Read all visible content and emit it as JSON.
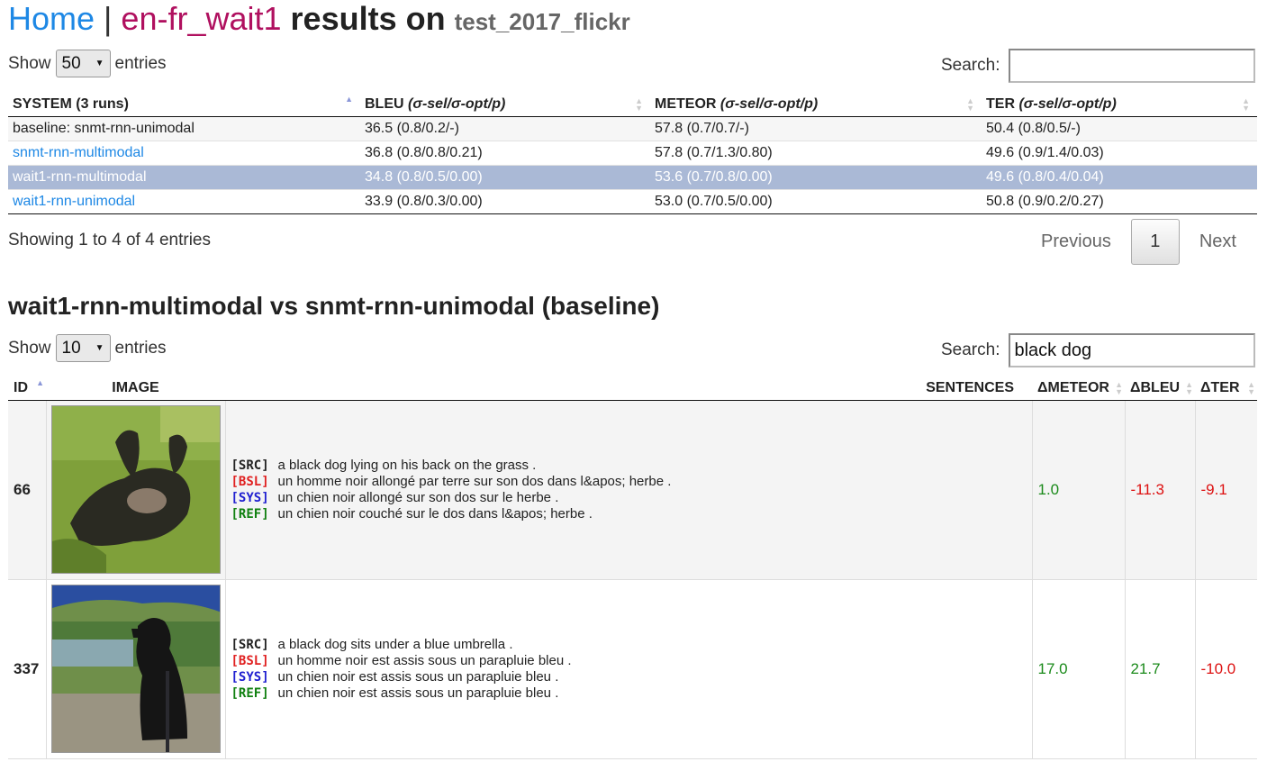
{
  "header": {
    "home": "Home",
    "separator": "|",
    "task": "en-fr_wait1",
    "results_on": "results on",
    "dataset": "test_2017_flickr"
  },
  "table1": {
    "show_label": "Show",
    "show_value": "50",
    "entries_label": "entries",
    "search_label": "Search:",
    "search_value": "",
    "columns": [
      {
        "name": "SYSTEM (3 runs)",
        "italic": ""
      },
      {
        "name": "BLEU ",
        "italic": "(σ-sel/σ-opt/p)"
      },
      {
        "name": "METEOR ",
        "italic": "(σ-sel/σ-opt/p)"
      },
      {
        "name": "TER ",
        "italic": "(σ-sel/σ-opt/p)"
      }
    ],
    "rows": [
      {
        "system": "baseline: snmt-rnn-unimodal",
        "bleu": "36.5 (0.8/0.2/-)",
        "meteor": "57.8 (0.7/0.7/-)",
        "ter": "50.4 (0.8/0.5/-)"
      },
      {
        "system": "snmt-rnn-multimodal",
        "bleu": "36.8 (0.8/0.8/0.21)",
        "meteor": "57.8 (0.7/1.3/0.80)",
        "ter": "49.6 (0.9/1.4/0.03)"
      },
      {
        "system": "wait1-rnn-multimodal",
        "bleu": "34.8 (0.8/0.5/0.00)",
        "meteor": "53.6 (0.7/0.8/0.00)",
        "ter": "49.6 (0.8/0.4/0.04)"
      },
      {
        "system": "wait1-rnn-unimodal",
        "bleu": "33.9 (0.8/0.3/0.00)",
        "meteor": "53.0 (0.7/0.5/0.00)",
        "ter": "50.8 (0.9/0.2/0.27)"
      }
    ],
    "info": "Showing 1 to 4 of 4 entries",
    "pager": {
      "previous": "Previous",
      "current": "1",
      "next": "Next"
    }
  },
  "comparison": {
    "title": "wait1-rnn-multimodal vs snmt-rnn-unimodal (baseline)",
    "show_label": "Show",
    "show_value": "10",
    "entries_label": "entries",
    "search_label": "Search:",
    "search_value": "black dog",
    "columns": {
      "id": "ID",
      "image": "IMAGE",
      "sentences": "SENTENCES",
      "dmeteor": "ΔMETEOR",
      "dbleu": "ΔBLEU",
      "dter": "ΔTER"
    },
    "tags": {
      "src": "[SRC]",
      "bsl": "[BSL]",
      "sys": "[SYS]",
      "ref": "[REF]"
    },
    "rows": [
      {
        "id": "66",
        "src": "a black dog lying on his back on the grass .",
        "bsl": "un homme noir allongé par terre sur son dos dans l&apos; herbe .",
        "sys": "un chien noir allongé sur son dos sur le herbe .",
        "ref": "un chien noir couché sur le dos dans l&apos; herbe .",
        "dmeteor": "1.0",
        "dbleu": "-11.3",
        "dter": "-9.1"
      },
      {
        "id": "337",
        "src": "a black dog sits under a blue umbrella .",
        "bsl": "un homme noir est assis sous un parapluie bleu .",
        "sys": "un chien noir est assis sous un parapluie bleu .",
        "ref": "un chien noir est assis sous un parapluie bleu .",
        "dmeteor": "17.0",
        "dbleu": "21.7",
        "dter": "-10.0"
      }
    ]
  },
  "colors": {
    "link": "#1e88e5",
    "task": "#b0105f",
    "selected_row": "#aab9d6",
    "positive": "#1a8a1a",
    "negative": "#dd1111"
  }
}
